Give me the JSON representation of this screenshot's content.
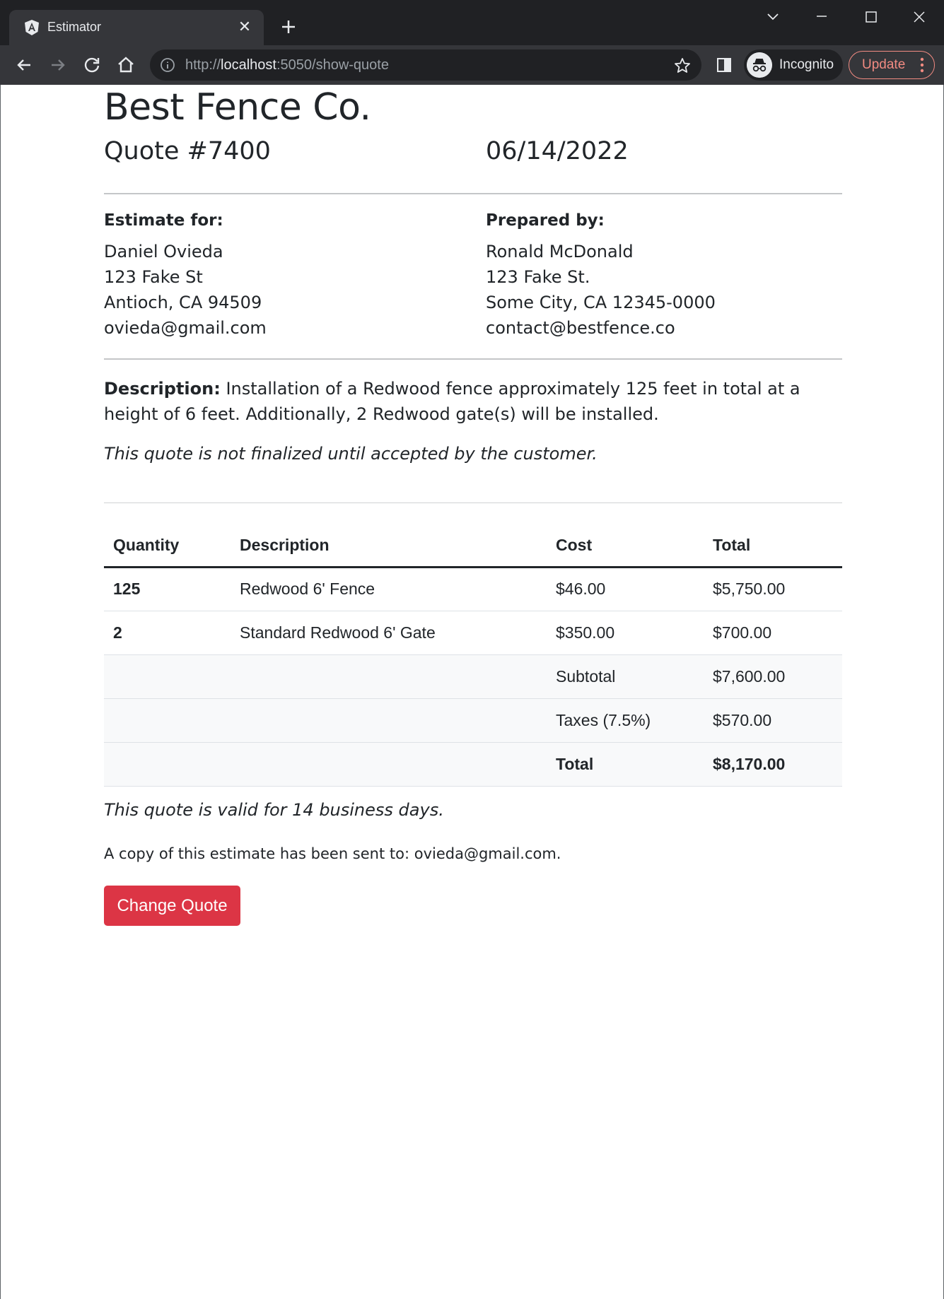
{
  "browser": {
    "tab_title": "Estimator",
    "url_scheme": "http://",
    "url_host": "localhost",
    "url_rest": ":5050/show-quote",
    "profile_label": "Incognito",
    "update_label": "Update",
    "accent_update": "#f28b82"
  },
  "quote": {
    "company": "Best Fence Co.",
    "number": "Quote #7400",
    "date": "06/14/2022",
    "estimate_for": {
      "label": "Estimate for:",
      "name": "Daniel Ovieda",
      "street": "123 Fake St",
      "city": "Antioch, CA 94509",
      "email": "ovieda@gmail.com"
    },
    "prepared_by": {
      "label": "Prepared by:",
      "name": "Ronald McDonald",
      "street": "123 Fake St.",
      "city": "Some City, CA 12345-0000",
      "email": "contact@bestfence.co"
    },
    "description_label": "Description:",
    "description": "Installation of a Redwood fence approximately 125 feet in total at a height of 6 feet. Additionally, 2 Redwood gate(s) will be installed.",
    "not_final_note": "This quote is not finalized until accepted by the customer.",
    "table": {
      "headers": [
        "Quantity",
        "Description",
        "Cost",
        "Total"
      ],
      "rows": [
        {
          "quantity": "125",
          "description": "Redwood 6' Fence",
          "cost": "$46.00",
          "total": "$5,750.00"
        },
        {
          "quantity": "2",
          "description": "Standard Redwood 6' Gate",
          "cost": "$350.00",
          "total": "$700.00"
        }
      ],
      "subtotal_label": "Subtotal",
      "subtotal": "$7,600.00",
      "taxes_label": "Taxes (7.5%)",
      "taxes": "$570.00",
      "total_label": "Total",
      "total": "$8,170.00"
    },
    "valid_note": "This quote is valid for 14 business days.",
    "copy_note": "A copy of this estimate has been sent to: ovieda@gmail.com.",
    "change_button": "Change Quote",
    "accent_button": "#dc3545"
  }
}
